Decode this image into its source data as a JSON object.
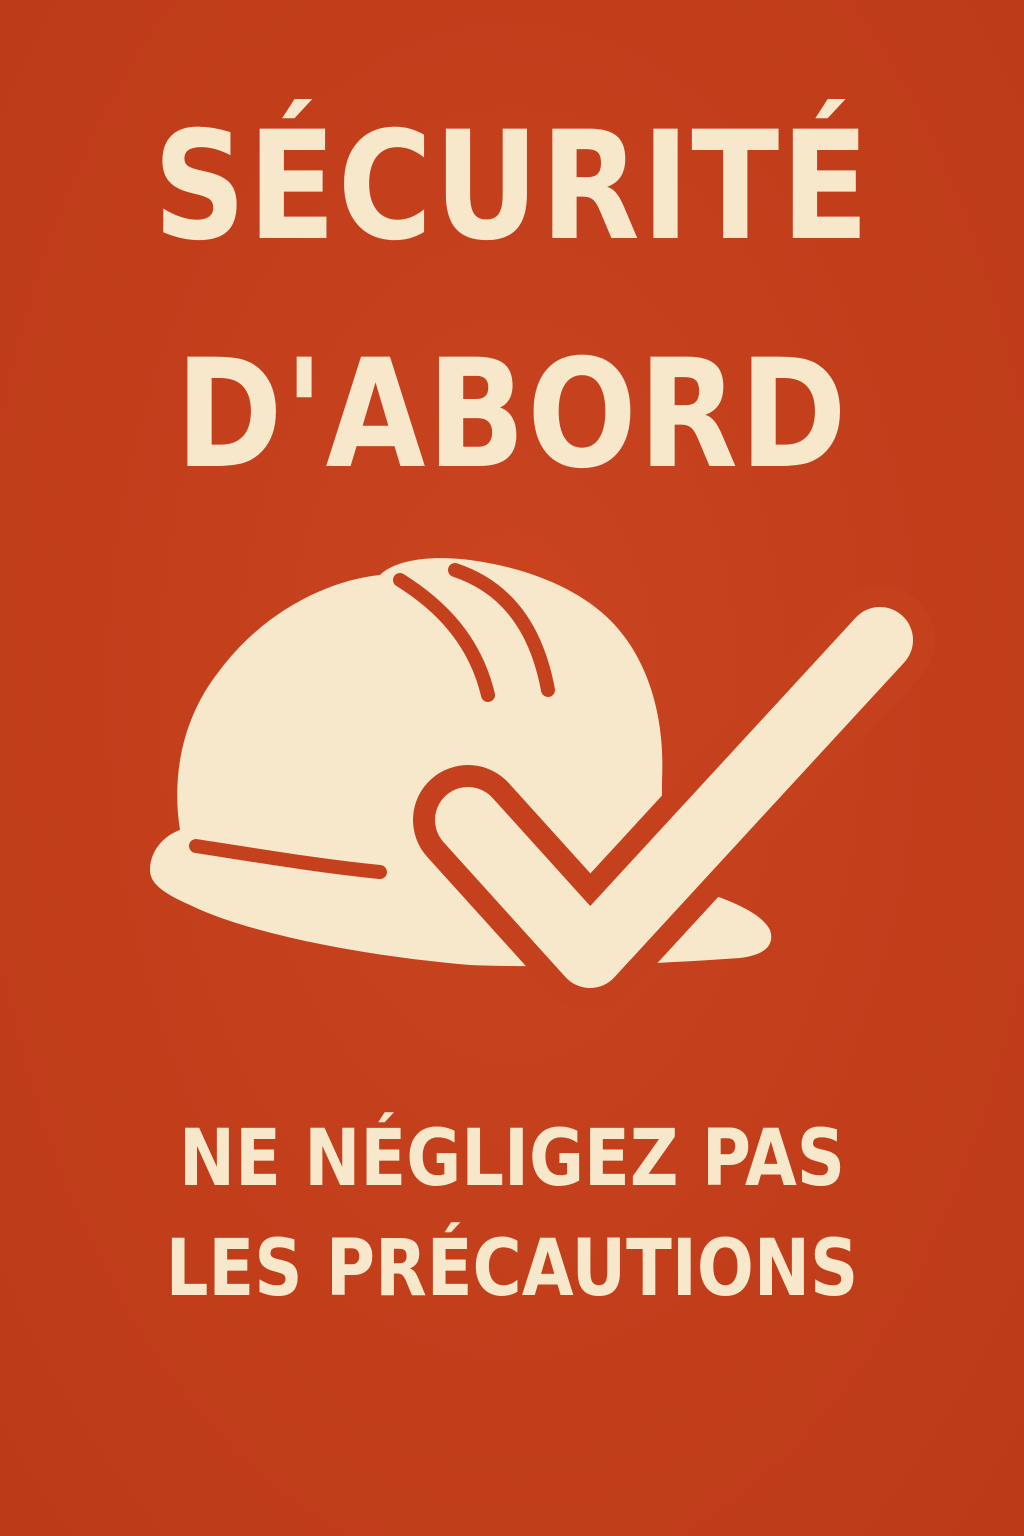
{
  "poster": {
    "headline_line1": "SÉCURITÉ",
    "headline_line2": "D'ABORD",
    "subline_line1": "NE NÉGLIGEZ PAS",
    "subline_line2": "LES PRÉCAUTIONS"
  },
  "emblem": {
    "icons": [
      "hard-hat-icon",
      "checkmark-icon"
    ]
  },
  "colors": {
    "background": "#c5401c",
    "foreground": "#f7e8cc"
  }
}
